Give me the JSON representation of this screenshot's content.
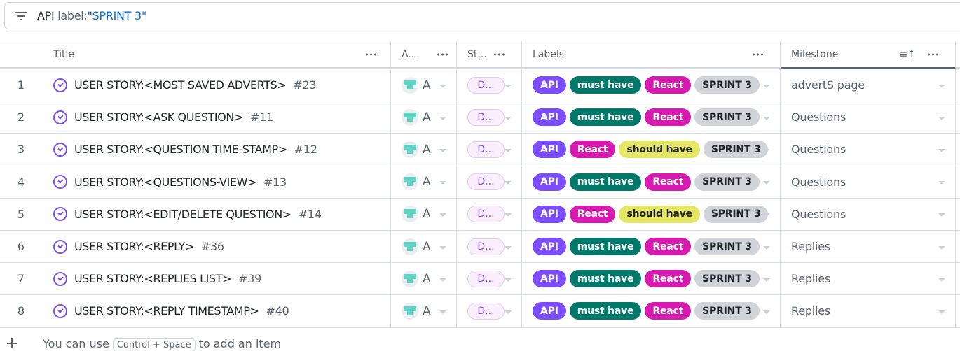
{
  "filter": {
    "keyword": "API",
    "qualifier": "label:",
    "value": "\"SPRINT 3\""
  },
  "columns": {
    "title": "Title",
    "assignees": "A...",
    "status": "St...",
    "labels": "Labels",
    "milestone": "Milestone"
  },
  "label_colors": {
    "API": {
      "bg": "#7c4dff",
      "fg": "#ffffff"
    },
    "must have": {
      "bg": "#00796b",
      "fg": "#ffffff"
    },
    "React": {
      "bg": "#d81bb0",
      "fg": "#ffffff"
    },
    "should have": {
      "bg": "#e5e566",
      "fg": "#1f2328"
    },
    "SPRINT 3": {
      "bg": "#d0d3d8",
      "fg": "#1f2328"
    }
  },
  "rows": [
    {
      "num": "1",
      "title": "USER STORY:<MOST SAVED ADVERTS>",
      "issue": "#23",
      "assignee": "A",
      "status": "D...",
      "labels": [
        "API",
        "must have",
        "React",
        "SPRINT 3"
      ],
      "milestone": "advertS page"
    },
    {
      "num": "2",
      "title": "USER STORY:<ASK QUESTION>",
      "issue": "#11",
      "assignee": "A",
      "status": "D...",
      "labels": [
        "API",
        "must have",
        "React",
        "SPRINT 3"
      ],
      "milestone": "Questions"
    },
    {
      "num": "3",
      "title": "USER STORY:<QUESTION TIME-STAMP>",
      "issue": "#12",
      "assignee": "A",
      "status": "D...",
      "labels": [
        "API",
        "React",
        "should have",
        "SPRINT 3"
      ],
      "milestone": "Questions"
    },
    {
      "num": "4",
      "title": "USER STORY:<QUESTIONS-VIEW>",
      "issue": "#13",
      "assignee": "A",
      "status": "D...",
      "labels": [
        "API",
        "must have",
        "React",
        "SPRINT 3"
      ],
      "milestone": "Questions"
    },
    {
      "num": "5",
      "title": "USER STORY:<EDIT/DELETE QUESTION>",
      "issue": "#14",
      "assignee": "A",
      "status": "D...",
      "labels": [
        "API",
        "React",
        "should have",
        "SPRINT 3"
      ],
      "milestone": "Questions"
    },
    {
      "num": "6",
      "title": "USER STORY:<REPLY>",
      "issue": "#36",
      "assignee": "A",
      "status": "D...",
      "labels": [
        "API",
        "must have",
        "React",
        "SPRINT 3"
      ],
      "milestone": "Replies"
    },
    {
      "num": "7",
      "title": "USER STORY:<REPLIES LIST>",
      "issue": "#39",
      "assignee": "A",
      "status": "D...",
      "labels": [
        "API",
        "must have",
        "React",
        "SPRINT 3"
      ],
      "milestone": "Replies"
    },
    {
      "num": "8",
      "title": "USER STORY:<REPLY TIMESTAMP>",
      "issue": "#40",
      "assignee": "A",
      "status": "D...",
      "labels": [
        "API",
        "must have",
        "React",
        "SPRINT 3"
      ],
      "milestone": "Replies"
    }
  ],
  "footer": {
    "prefix": "You can use",
    "shortcut": "Control + Space",
    "suffix": "to add an item"
  },
  "icons": {
    "filter": "filter-icon",
    "issue": "issue-closed-icon",
    "sort": "sort-ascending-icon",
    "add": "plus-icon"
  }
}
